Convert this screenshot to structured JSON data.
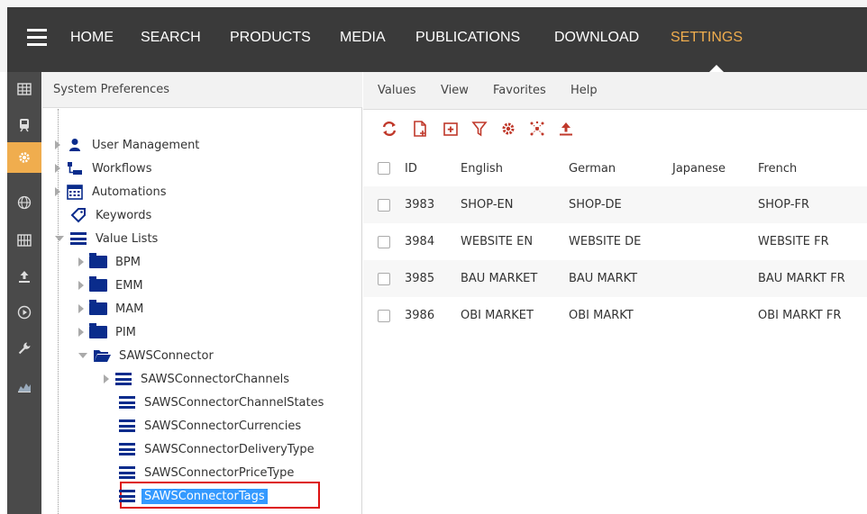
{
  "nav": {
    "items": [
      "HOME",
      "SEARCH",
      "PRODUCTS",
      "MEDIA",
      "PUBLICATIONS",
      "DOWNLOAD",
      "SETTINGS"
    ],
    "active": "SETTINGS",
    "accent_color": "#f0ad4e"
  },
  "sidebar": {
    "icons": [
      "table-icon",
      "train-icon",
      "gear-icon",
      "globe-icon",
      "grid-icon",
      "upload-icon",
      "play-icon",
      "wrench-icon",
      "chart-icon"
    ],
    "active": "gear-icon"
  },
  "tree": {
    "title": "System Preferences",
    "items": [
      {
        "label": "User Management",
        "icon": "user-icon"
      },
      {
        "label": "Workflows",
        "icon": "workflow-icon"
      },
      {
        "label": "Automations",
        "icon": "calendar-icon"
      },
      {
        "label": "Keywords",
        "icon": "tag-icon"
      },
      {
        "label": "Value Lists",
        "icon": "list-icon"
      },
      {
        "label": "BPM",
        "icon": "folder-icon"
      },
      {
        "label": "EMM",
        "icon": "folder-icon"
      },
      {
        "label": "MAM",
        "icon": "folder-icon"
      },
      {
        "label": "PIM",
        "icon": "folder-icon"
      },
      {
        "label": "SAWSConnector",
        "icon": "folder-open-icon"
      },
      {
        "label": "SAWSConnectorChannels",
        "icon": "list-icon"
      },
      {
        "label": "SAWSConnectorChannelStates",
        "icon": "list-icon"
      },
      {
        "label": "SAWSConnectorCurrencies",
        "icon": "list-icon"
      },
      {
        "label": "SAWSConnectorDeliveryType",
        "icon": "list-icon"
      },
      {
        "label": "SAWSConnectorPriceType",
        "icon": "list-icon"
      },
      {
        "label": "SAWSConnectorTags",
        "icon": "list-icon",
        "selected": true
      }
    ]
  },
  "menu": {
    "items": [
      "Values",
      "View",
      "Favorites",
      "Help"
    ]
  },
  "toolbar": {
    "icons": [
      "refresh-icon",
      "new-document-icon",
      "add-folder-icon",
      "filter-icon",
      "settings-icon",
      "network-icon",
      "export-icon"
    ],
    "icon_color": "#c0392b"
  },
  "table": {
    "columns": [
      "ID",
      "English",
      "German",
      "Japanese",
      "French"
    ],
    "rows": [
      [
        "3983",
        "SHOP-EN",
        "SHOP-DE",
        "",
        "SHOP-FR"
      ],
      [
        "3984",
        "WEBSITE EN",
        "WEBSITE DE",
        "",
        "WEBSITE FR"
      ],
      [
        "3985",
        "BAU MARKET",
        "BAU MARKT",
        "",
        "BAU MARKT FR"
      ],
      [
        "3986",
        "OBI MARKET",
        "OBI MARKT",
        "",
        "OBI MARKT FR"
      ]
    ]
  }
}
